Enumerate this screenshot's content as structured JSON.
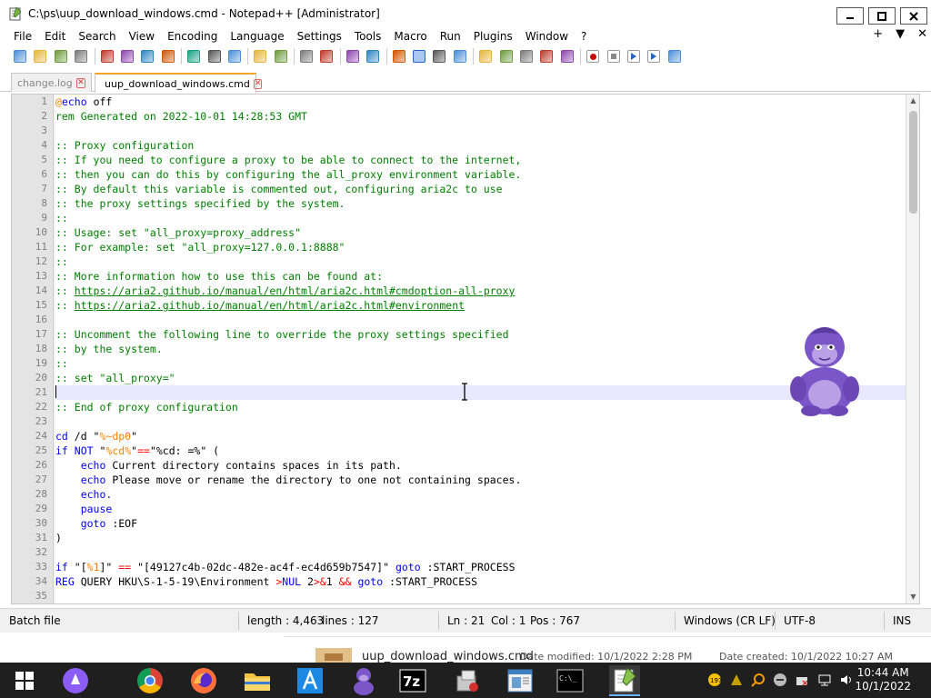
{
  "window": {
    "title": "C:\\ps\\uup_download_windows.cmd - Notepad++ [Administrator]"
  },
  "menu": [
    "File",
    "Edit",
    "Search",
    "View",
    "Encoding",
    "Language",
    "Settings",
    "Tools",
    "Macro",
    "Run",
    "Plugins",
    "Window",
    "?"
  ],
  "menu_right": {
    "plus": "+",
    "down": "▼",
    "close": "✕"
  },
  "toolbar_icons": [
    "new-file-icon",
    "open-file-icon",
    "save-icon",
    "save-all-icon",
    "close-icon",
    "close-all-icon",
    "print-icon",
    "cut-icon",
    "copy-icon",
    "paste-icon",
    "undo-icon",
    "redo-icon",
    "find-icon",
    "replace-icon",
    "zoom-in-icon",
    "zoom-out-icon",
    "sync-vertical-icon",
    "sync-horizontal-icon",
    "word-wrap-icon",
    "show-all-chars-icon",
    "indent-guide-icon",
    "user-language-icon",
    "doc-map-icon",
    "function-list-icon",
    "folder-workspace-icon",
    "monitoring-icon",
    "record-macro-icon",
    "stop-record-icon",
    "play-macro-icon",
    "run-macro-multiple-icon",
    "save-macro-icon"
  ],
  "tabs": [
    {
      "label": "change.log",
      "active": false
    },
    {
      "label": "uup_download_windows.cmd",
      "active": true
    }
  ],
  "editor": {
    "current_line": 21,
    "lines": [
      {
        "n": "1",
        "html": "<span class='c-at'>@</span><span class='c-kw'>echo</span> off"
      },
      {
        "n": "2",
        "html": "<span class='c-cm'>rem Generated on 2022-10-01 14:28:53 GMT</span>"
      },
      {
        "n": "3",
        "html": ""
      },
      {
        "n": "4",
        "html": "<span class='c-cm'>:: Proxy configuration</span>"
      },
      {
        "n": "5",
        "html": "<span class='c-cm'>:: If you need to configure a proxy to be able to connect to the internet,</span>"
      },
      {
        "n": "6",
        "html": "<span class='c-cm'>:: then you can do this by configuring the all_proxy environment variable.</span>"
      },
      {
        "n": "7",
        "html": "<span class='c-cm'>:: By default this variable is commented out, configuring aria2c to use</span>"
      },
      {
        "n": "8",
        "html": "<span class='c-cm'>:: the proxy settings specified by the system.</span>"
      },
      {
        "n": "9",
        "html": "<span class='c-cm'>::</span>"
      },
      {
        "n": "10",
        "html": "<span class='c-cm'>:: Usage: set \"all_proxy=proxy_address\"</span>"
      },
      {
        "n": "11",
        "html": "<span class='c-cm'>:: For example: set \"all_proxy=127.0.0.1:8888\"</span>"
      },
      {
        "n": "12",
        "html": "<span class='c-cm'>::</span>"
      },
      {
        "n": "13",
        "html": "<span class='c-cm'>:: More information how to use this can be found at:</span>"
      },
      {
        "n": "14",
        "html": "<span class='c-cm'>:: </span><span class='c-url'>https://aria2.github.io/manual/en/html/aria2c.html#cmdoption-all-proxy</span>"
      },
      {
        "n": "15",
        "html": "<span class='c-cm'>:: </span><span class='c-url'>https://aria2.github.io/manual/en/html/aria2c.html#environment</span>"
      },
      {
        "n": "16",
        "html": ""
      },
      {
        "n": "17",
        "html": "<span class='c-cm'>:: Uncomment the following line to override the proxy settings specified</span>"
      },
      {
        "n": "18",
        "html": "<span class='c-cm'>:: by the system.</span>"
      },
      {
        "n": "19",
        "html": "<span class='c-cm'>::</span>"
      },
      {
        "n": "20",
        "html": "<span class='c-cm'>:: set \"all_proxy=\"</span>"
      },
      {
        "n": "21",
        "html": ""
      },
      {
        "n": "22",
        "html": "<span class='c-cm'>:: End of proxy configuration</span>"
      },
      {
        "n": "23",
        "html": ""
      },
      {
        "n": "24",
        "html": "<span class='c-kw'>cd</span> /d \"<span class='c-var'>%~dp0</span>\""
      },
      {
        "n": "25",
        "html": "<span class='c-kw'>if</span> <span class='c-kw'>NOT</span> \"<span class='c-var'>%cd%</span>\"<span class='c-op'>==</span>\"%cd: =%\" ("
      },
      {
        "n": "26",
        "html": "    <span class='c-kw'>echo</span> Current directory contains spaces in its path."
      },
      {
        "n": "27",
        "html": "    <span class='c-kw'>echo</span> Please move or rename the directory to one not containing spaces."
      },
      {
        "n": "28",
        "html": "    <span class='c-kw'>echo.</span>"
      },
      {
        "n": "29",
        "html": "    <span class='c-kw'>pause</span>"
      },
      {
        "n": "30",
        "html": "    <span class='c-kw'>goto</span> :EOF"
      },
      {
        "n": "31",
        "html": ")"
      },
      {
        "n": "32",
        "html": ""
      },
      {
        "n": "33",
        "html": "<span class='c-kw'>if</span> \"[<span class='c-var'>%1</span>]\" <span class='c-op'>==</span> \"[49127c4b-02dc-482e-ac4f-ec4d659b7547]\" <span class='c-kw'>goto</span> :START_PROCESS"
      },
      {
        "n": "34",
        "html": "<span class='c-kw'>REG</span> QUERY HKU\\S-1-5-19\\Environment <span class='c-op'>&gt;</span><span class='c-nul'>NUL</span> 2<span class='c-op'>&gt;&amp;</span>1 <span class='c-op'>&amp;&amp;</span> <span class='c-kw'>goto</span> :START_PROCESS"
      },
      {
        "n": "35",
        "html": ""
      }
    ]
  },
  "status": {
    "filetype": "Batch file",
    "length": "length : 4,463",
    "lines": "lines : 127",
    "ln": "Ln : 21",
    "col": "Col : 1",
    "pos": "Pos : 767",
    "eol": "Windows (CR LF)",
    "encoding": "UTF-8",
    "mode": "INS"
  },
  "explorer_row": {
    "filename": "uup_download_windows.cmd",
    "modified": "Date modified: 10/1/2022 2:28 PM",
    "created": "Date created: 10/1/2022 10:27 AM"
  },
  "taskbar": {
    "apps": [
      "start-icon",
      "cortana-icon",
      "chrome-icon",
      "firefox-icon",
      "file-explorer-icon",
      "app-a-icon",
      "bonzi-icon",
      "7zip-icon",
      "installer-icon",
      "document-viewer-icon",
      "terminal-icon",
      "notepadpp-icon"
    ],
    "time": "10:44 AM",
    "date": "10/1/2022"
  },
  "colors": {
    "accent": "#f9a32b",
    "comment": "#008000",
    "keyword": "#0000ff",
    "variable": "#ff8000",
    "operator": "#ff0000",
    "mascot": "#7b56c9"
  }
}
